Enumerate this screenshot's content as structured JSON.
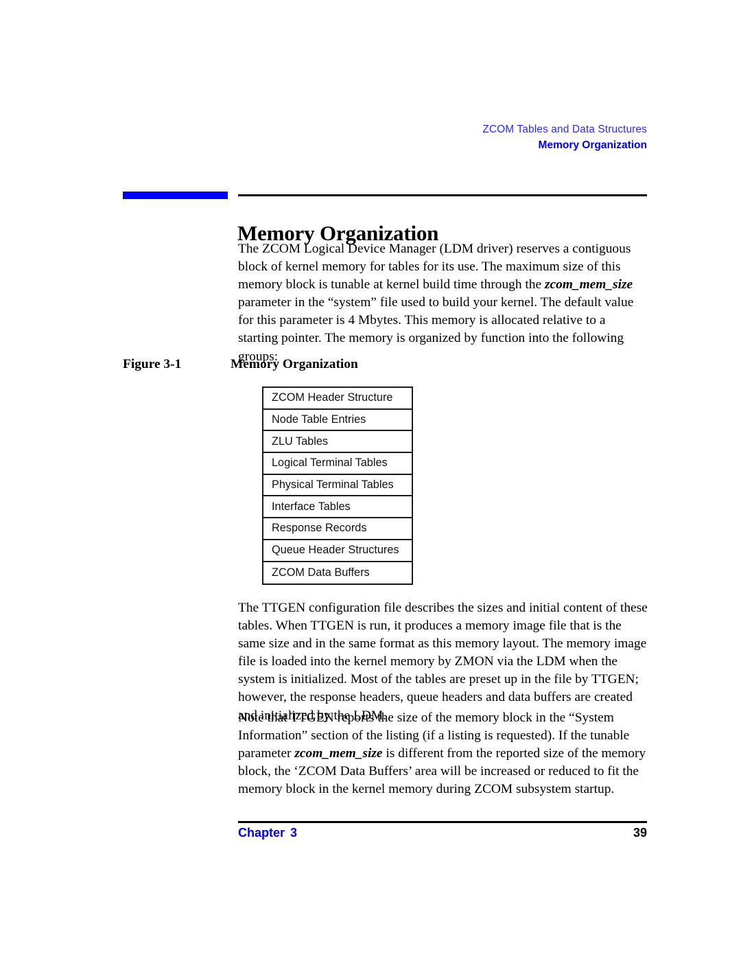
{
  "header": {
    "line1": "ZCOM Tables and Data Structures",
    "line2": "Memory Organization"
  },
  "section": {
    "title": "Memory Organization"
  },
  "paragraphs": {
    "p1_a": "The ZCOM Logical Device Manager (LDM driver) reserves a contiguous block of kernel memory for tables for its use. The maximum size of this memory block is tunable at kernel build time through the ",
    "p1_param": "zcom_mem_size",
    "p1_b": " parameter in the “system” file used to build your kernel. The default value for this parameter is 4 Mbytes. This memory is allocated relative to a starting pointer. The memory is organized by function into the following groups:",
    "p2": "The TTGEN configuration file describes the sizes and initial content of these tables. When TTGEN is run, it produces a memory image file that is the same size and in the same format as this memory layout. The memory image file is loaded into the kernel memory by ZMON via the LDM when the system is initialized. Most of the tables are preset up in the file by TTGEN; however, the response headers, queue headers and data buffers are created and initialized by the LDM.",
    "p3_a": "Note that TTGEN reports the size of the memory block in the “System Information” section of the listing (if a listing is requested). If the tunable parameter ",
    "p3_param": "zcom_mem_size",
    "p3_b": " is different from the reported size of the memory block, the ‘ZCOM Data Buffers’ area will be increased or reduced to fit the memory block in the kernel memory during ZCOM subsystem startup."
  },
  "figure": {
    "number": "Figure 3-1",
    "title": "Memory Organization",
    "rows": [
      "ZCOM Header Structure",
      "Node Table Entries",
      "ZLU Tables",
      "Logical Terminal Tables",
      "Physical Terminal Tables",
      "Interface Tables",
      "Response Records",
      "Queue Header Structures",
      "ZCOM Data Buffers"
    ]
  },
  "footer": {
    "chapter_label": "Chapter",
    "chapter_number": "3",
    "page_number": "39"
  },
  "colors": {
    "header_blue": "#2b2bf2",
    "accent_blue": "#0000ff",
    "footer_blue": "#0000ee"
  }
}
